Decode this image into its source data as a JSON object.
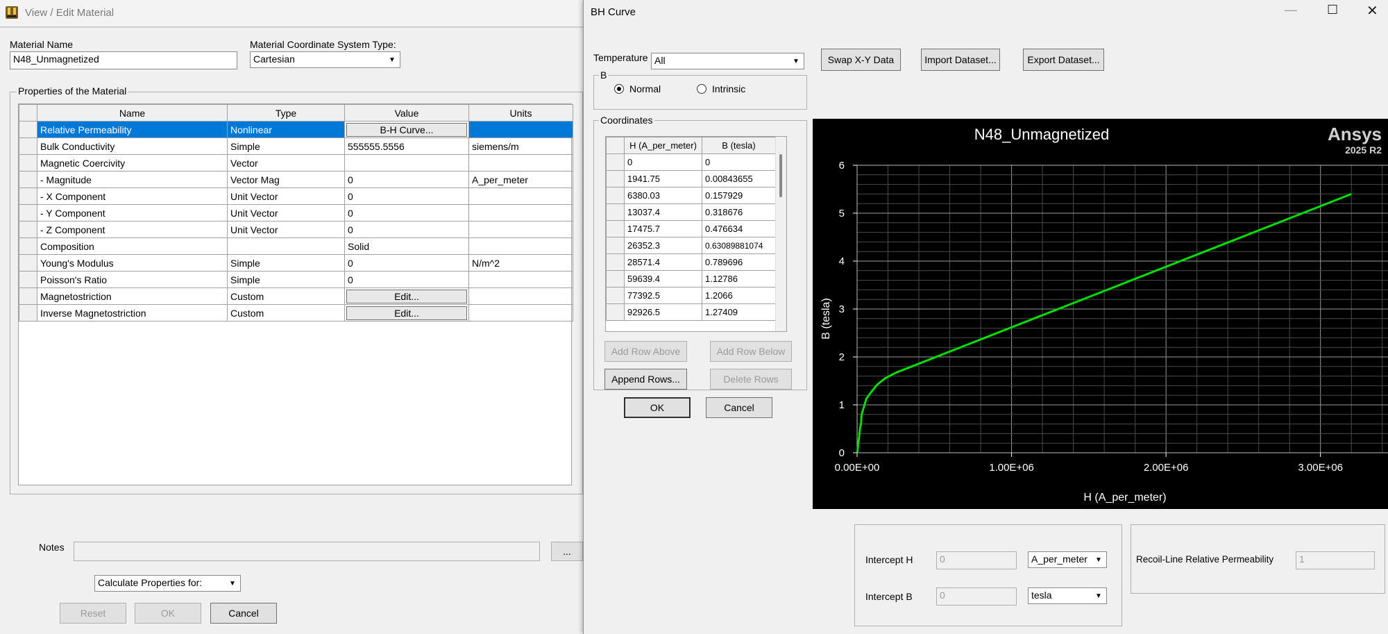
{
  "left_window": {
    "title": "View / Edit Material",
    "material_name_label": "Material Name",
    "material_name_value": "N48_Unmagnetized",
    "coord_system_label": "Material Coordinate System Type:",
    "coord_system_value": "Cartesian",
    "properties_group_label": "Properties of the Material",
    "columns": [
      "Name",
      "Type",
      "Value",
      "Units"
    ],
    "rows": [
      {
        "name": "Relative Permeability",
        "type": "Nonlinear",
        "value": "B-H Curve...",
        "units": ""
      },
      {
        "name": "Bulk Conductivity",
        "type": "Simple",
        "value": "555555.5556",
        "units": "siemens/m"
      },
      {
        "name": "Magnetic Coercivity",
        "type": "Vector",
        "value": "",
        "units": ""
      },
      {
        "name": "-  Magnitude",
        "type": "Vector Mag",
        "value": "0",
        "units": "A_per_meter"
      },
      {
        "name": "- X Component",
        "type": "Unit Vector",
        "value": "0",
        "units": ""
      },
      {
        "name": "- Y Component",
        "type": "Unit Vector",
        "value": "0",
        "units": ""
      },
      {
        "name": "- Z Component",
        "type": "Unit Vector",
        "value": "0",
        "units": ""
      },
      {
        "name": "Composition",
        "type": "",
        "value": "Solid",
        "units": ""
      },
      {
        "name": "Young's Modulus",
        "type": "Simple",
        "value": "0",
        "units": "N/m^2"
      },
      {
        "name": "Poisson's Ratio",
        "type": "Simple",
        "value": "0",
        "units": ""
      },
      {
        "name": "Magnetostriction",
        "type": "Custom",
        "value": "Edit...",
        "units": ""
      },
      {
        "name": "Inverse Magnetostriction",
        "type": "Custom",
        "value": "Edit...",
        "units": ""
      }
    ],
    "notes_label": "Notes",
    "notes_value": "",
    "notes_button": "...",
    "calc_props_value": "Calculate Properties for:",
    "reset_label": "Reset",
    "ok_label": "OK",
    "cancel_label": "Cancel"
  },
  "bh_window": {
    "title": "BH Curve",
    "temperature_label": "Temperature",
    "temperature_value": "All",
    "swap_label": "Swap X-Y Data",
    "import_label": "Import Dataset...",
    "export_label": "Export Dataset...",
    "b_group_label": "B",
    "normal_label": "Normal",
    "intrinsic_label": "Intrinsic",
    "normal_selected": true,
    "coords_group_label": "Coordinates",
    "coord_columns": [
      "H (A_per_meter)",
      "B (tesla)"
    ],
    "coord_rows": [
      [
        "0",
        "0"
      ],
      [
        "1941.75",
        "0.00843655"
      ],
      [
        "6380.03",
        "0.157929"
      ],
      [
        "13037.4",
        "0.318676"
      ],
      [
        "17475.7",
        "0.476634"
      ],
      [
        "26352.3",
        "0.63089881074"
      ],
      [
        "28571.4",
        "0.789696"
      ],
      [
        "59639.4",
        "1.12786"
      ],
      [
        "77392.5",
        "1.2066"
      ],
      [
        "92926.5",
        "1.27409"
      ]
    ],
    "add_above_label": "Add Row Above",
    "add_below_label": "Add Row Below",
    "append_label": "Append Rows...",
    "delete_label": "Delete Rows",
    "ok_label": "OK",
    "cancel_label": "Cancel",
    "intercept_h_label": "Intercept H",
    "intercept_h_value": "0",
    "intercept_h_unit": "A_per_meter",
    "intercept_b_label": "Intercept B",
    "intercept_b_value": "0",
    "intercept_b_unit": "tesla",
    "recoil_label": "Recoil-Line Relative Permeability",
    "recoil_value": "1"
  },
  "chart_data": {
    "type": "line",
    "title": "N48_Unmagnetized",
    "brand": "Ansys",
    "version": "2025 R2",
    "xlabel": "H (A_per_meter)",
    "ylabel": "B (tesla)",
    "xlim": [
      0,
      3500000
    ],
    "ylim": [
      0,
      6
    ],
    "x_ticks": [
      0,
      1000000,
      2000000,
      3000000
    ],
    "x_tick_labels": [
      "0.00E+00",
      "1.00E+06",
      "2.00E+06",
      "3.00E+06"
    ],
    "y_ticks": [
      0,
      1,
      2,
      3,
      4,
      5,
      6
    ],
    "y_tick_labels": [
      "0",
      "1",
      "2",
      "3",
      "4",
      "5",
      "6"
    ],
    "grid": true,
    "line_color": "#00dd00",
    "series": [
      {
        "x": [
          0,
          1941.75,
          6380.03,
          13037.4,
          17475.7,
          26352.3,
          28571.4,
          59639.4,
          77392.5,
          92926.5,
          130000,
          180000,
          250000,
          3200000
        ],
        "y": [
          0,
          0.00843655,
          0.157929,
          0.318676,
          0.476634,
          0.63089881074,
          0.789696,
          1.12786,
          1.2066,
          1.27409,
          1.42,
          1.55,
          1.67,
          5.4
        ]
      }
    ]
  }
}
